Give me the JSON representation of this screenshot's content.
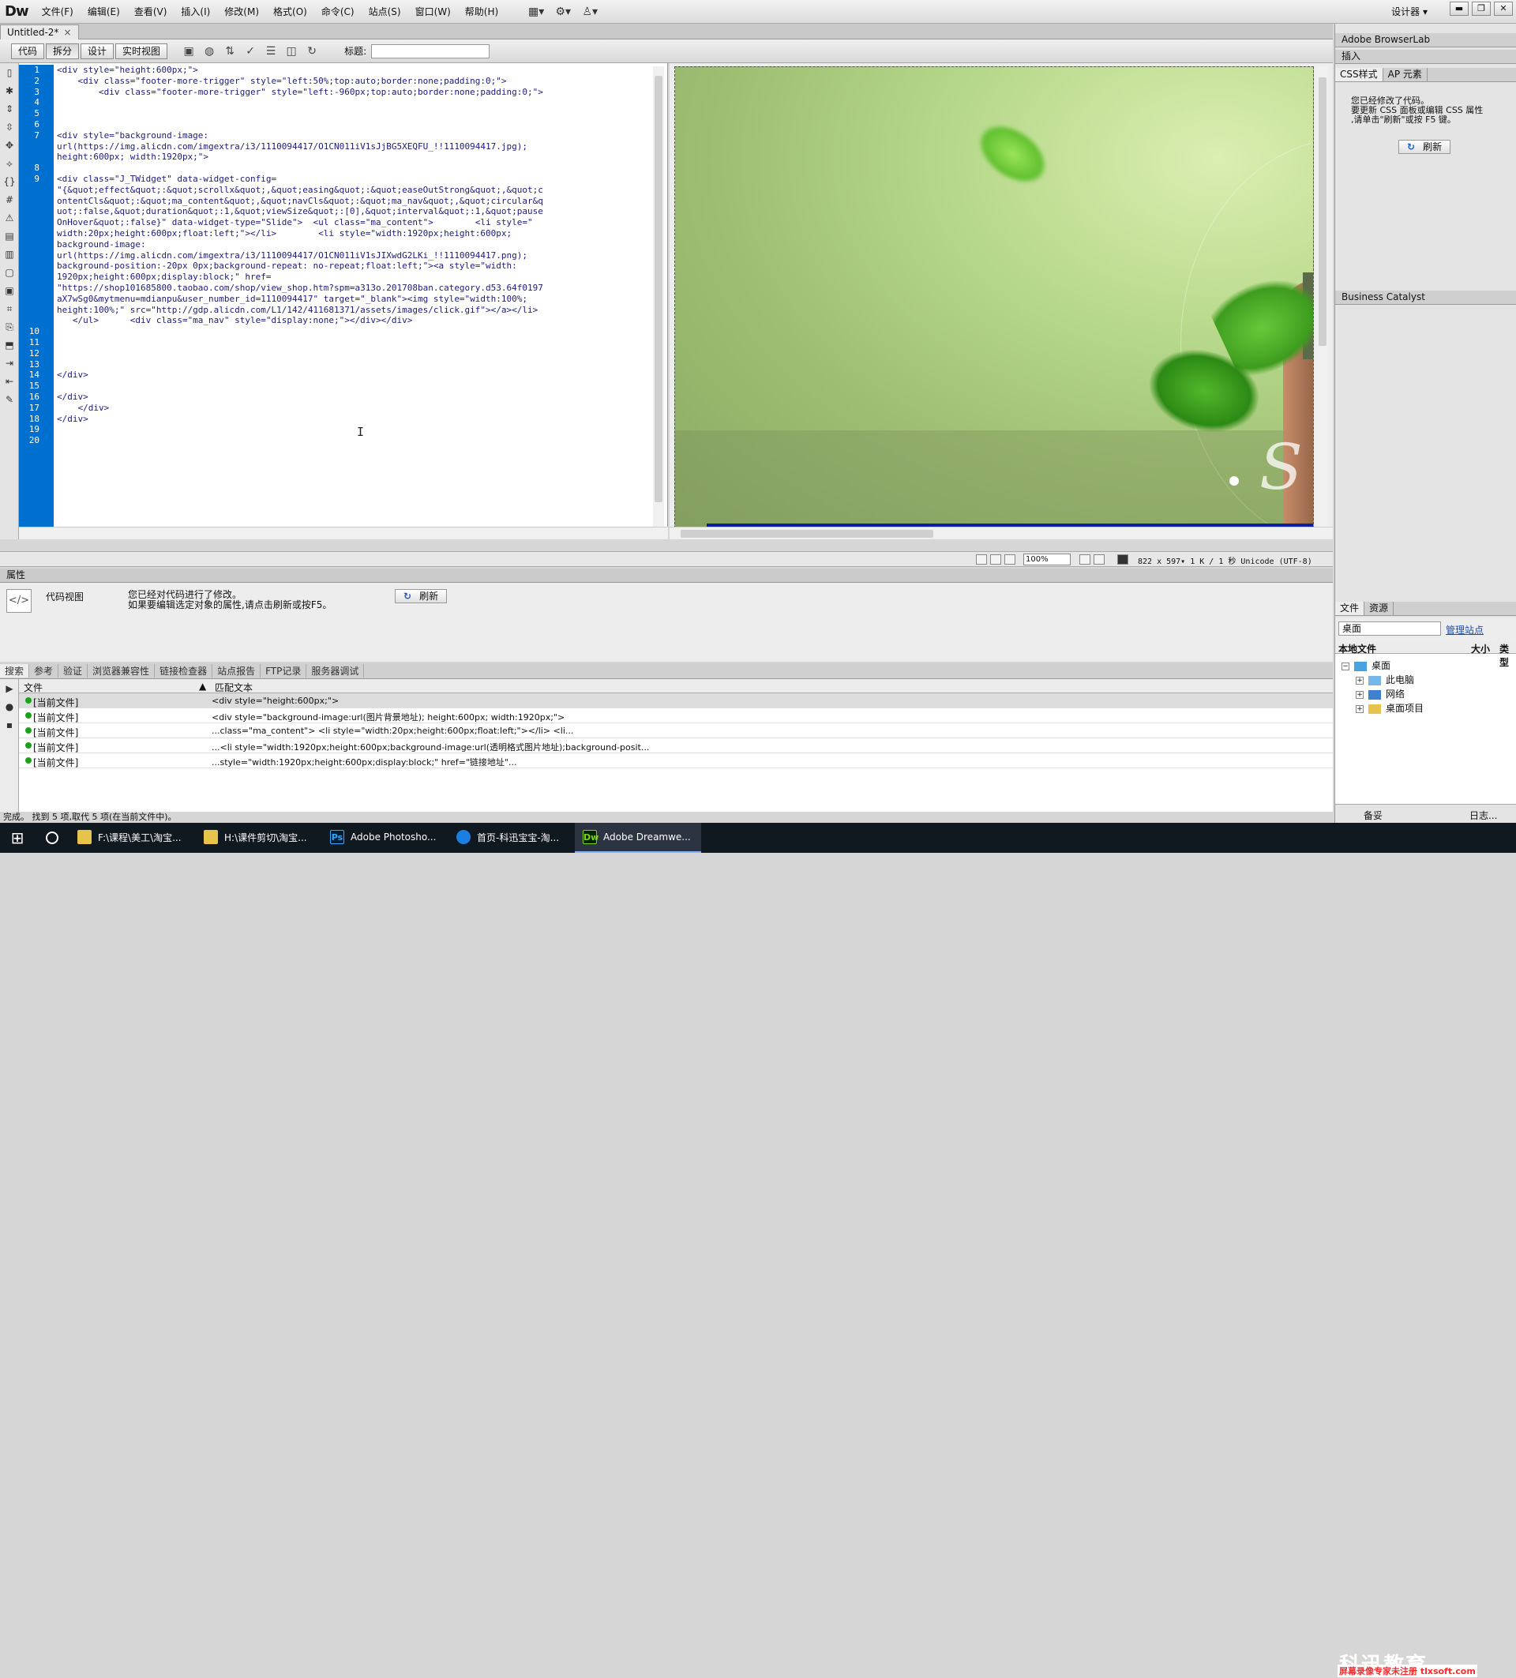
{
  "app": {
    "logo": "Dw",
    "designer": "设计器 ▾"
  },
  "menu": [
    "文件(F)",
    "编辑(E)",
    "查看(V)",
    "插入(I)",
    "修改(M)",
    "格式(O)",
    "命令(C)",
    "站点(S)",
    "窗口(W)",
    "帮助(H)"
  ],
  "window_controls": {
    "minimize": "▬",
    "restore": "❐",
    "close": "✕"
  },
  "document": {
    "tab": "Untitled-2*",
    "close": "×"
  },
  "doc_toolbar": {
    "code": "代码",
    "split": "拆分",
    "design": "设计",
    "live": "实时视图",
    "title_label": "标题:"
  },
  "code_lines": [
    {
      "n": "1",
      "t": "<div style=\"height:600px;\">"
    },
    {
      "n": "2",
      "t": "    <div class=\"footer-more-trigger\" style=\"left:50%;top:auto;border:none;padding:0;\">"
    },
    {
      "n": "3",
      "t": "        <div class=\"footer-more-trigger\" style=\"left:-960px;top:auto;border:none;padding:0;\">"
    },
    {
      "n": "4",
      "t": ""
    },
    {
      "n": "5",
      "t": ""
    },
    {
      "n": "6",
      "t": ""
    },
    {
      "n": "7",
      "t": "<div style=\"background-image:"
    },
    {
      "n": "",
      "t": "url(https://img.alicdn.com/imgextra/i3/1110094417/O1CN011iV1sJjBG5XEQFU_!!1110094417.jpg);"
    },
    {
      "n": "",
      "t": "height:600px; width:1920px;\">"
    },
    {
      "n": "8",
      "t": ""
    },
    {
      "n": "9",
      "t": "<div class=\"J_TWidget\" data-widget-config="
    },
    {
      "n": "",
      "t": "\"{&quot;effect&quot;:&quot;scrollx&quot;,&quot;easing&quot;:&quot;easeOutStrong&quot;,&quot;c"
    },
    {
      "n": "",
      "t": "ontentCls&quot;:&quot;ma_content&quot;,&quot;navCls&quot;:&quot;ma_nav&quot;,&quot;circular&q"
    },
    {
      "n": "",
      "t": "uot;:false,&quot;duration&quot;:1,&quot;viewSize&quot;:[0],&quot;interval&quot;:1,&quot;pause"
    },
    {
      "n": "",
      "t": "OnHover&quot;:false}\" data-widget-type=\"Slide\">  <ul class=\"ma_content\">        <li style=\""
    },
    {
      "n": "",
      "t": "width:20px;height:600px;float:left;\"></li>        <li style=\"width:1920px;height:600px;"
    },
    {
      "n": "",
      "t": "background-image:"
    },
    {
      "n": "",
      "t": "url(https://img.alicdn.com/imgextra/i3/1110094417/O1CN011iV1sJIXwdG2LKi_!!1110094417.png);"
    },
    {
      "n": "",
      "t": "background-position:-20px 0px;background-repeat: no-repeat;float:left;\"><a style=\"width:"
    },
    {
      "n": "",
      "t": "1920px;height:600px;display:block;\" href="
    },
    {
      "n": "",
      "t": "\"https://shop101685800.taobao.com/shop/view_shop.htm?spm=a313o.201708ban.category.d53.64f0197"
    },
    {
      "n": "",
      "t": "aX7wSg0&mytmenu=mdianpu&user_number_id=1110094417\" target=\"_blank\"><img style=\"width:100%;"
    },
    {
      "n": "",
      "t": "height:100%;\" src=\"http://gdp.alicdn.com/L1/142/411681371/assets/images/click.gif\"></a></li>"
    },
    {
      "n": "",
      "t": "   </ul>      <div class=\"ma_nav\" style=\"display:none;\"></div></div>"
    },
    {
      "n": "10",
      "t": ""
    },
    {
      "n": "11",
      "t": ""
    },
    {
      "n": "12",
      "t": ""
    },
    {
      "n": "13",
      "t": ""
    },
    {
      "n": "14",
      "t": "</div>"
    },
    {
      "n": "15",
      "t": ""
    },
    {
      "n": "16",
      "t": "</div>"
    },
    {
      "n": "17",
      "t": "    </div>"
    },
    {
      "n": "18",
      "t": "</div>"
    },
    {
      "n": "19",
      "t": ""
    },
    {
      "n": "20",
      "t": ""
    }
  ],
  "design": {
    "big_letter": "S"
  },
  "status": {
    "zoom": "100%",
    "info": "822 x 597▾ 1 K / 1 秒 Unicode (UTF-8)"
  },
  "properties": {
    "title": "属性",
    "view": "代码视图",
    "message1": "您已经对代码进行了修改。",
    "message2": "如果要编辑选定对象的属性,请点击刷新或按F5。",
    "refresh": "刷新"
  },
  "search_tabs": [
    "搜索",
    "参考",
    "验证",
    "浏览器兼容性",
    "链接检查器",
    "站点报告",
    "FTP记录",
    "服务器调试"
  ],
  "search_header": {
    "file": "文件",
    "match": "匹配文本"
  },
  "search_results": [
    {
      "file": "[当前文件]",
      "match": "<div style=\"height:600px;\">"
    },
    {
      "file": "[当前文件]",
      "match": " <div style=\"background-image:url(图片背景地址); height:600px; width:1920px;\">"
    },
    {
      "file": "[当前文件]",
      "match": "...class=\"ma_content\"> <li style=\"width:20px;height:600px;float:left;\"></li> <li..."
    },
    {
      "file": "[当前文件]",
      "match": "...<li style=\"width:1920px;height:600px;background-image:url(透明格式图片地址);background-posit..."
    },
    {
      "file": "[当前文件]",
      "match": "...style=\"width:1920px;height:600px;display:block;\" href=\"链接地址\"..."
    }
  ],
  "footer_status": "完成。 找到 5 项,取代 5 项(在当前文件中)。",
  "right_panels": {
    "browserlab": "Adobe BrowserLab",
    "insert": "插入",
    "css_tab": "CSS样式",
    "ap_tab": "AP 元素",
    "css_msg1": "您已经修改了代码。",
    "css_msg2": "要更新 CSS 面板或编辑 CSS 属性",
    "css_msg3": ",请单击\"刷新\"或按 F5 键。",
    "refresh": "刷新",
    "business": "Business Catalyst",
    "files_tab": "文件",
    "assets_tab": "资源",
    "site": "桌面",
    "manage": "管理站点",
    "local_files": "本地文件",
    "size_col": "大小",
    "type_col": "类型",
    "tree": [
      "桌面",
      "此电脑",
      "网络",
      "桌面项目"
    ],
    "footer_left": "备妥",
    "footer_right": "日志..."
  },
  "taskbar": [
    {
      "label": "F:\\课程\\美工\\淘宝...",
      "icon": "folder"
    },
    {
      "label": "H:\\课件剪切\\淘宝...",
      "icon": "folder"
    },
    {
      "label": "Adobe Photosho...",
      "icon": "Ps"
    },
    {
      "label": "首页-科迅宝宝-淘...",
      "icon": "browser"
    },
    {
      "label": "Adobe Dreamwe...",
      "icon": "Dw"
    }
  ],
  "watermark": {
    "brand": "科迅教育",
    "sub": "屏幕录像专家未注册 tlxsoft.com"
  },
  "colors": {
    "gutter": "#0070d0",
    "code_text": "#1b1b7a",
    "accent": "#1a4fb0"
  }
}
